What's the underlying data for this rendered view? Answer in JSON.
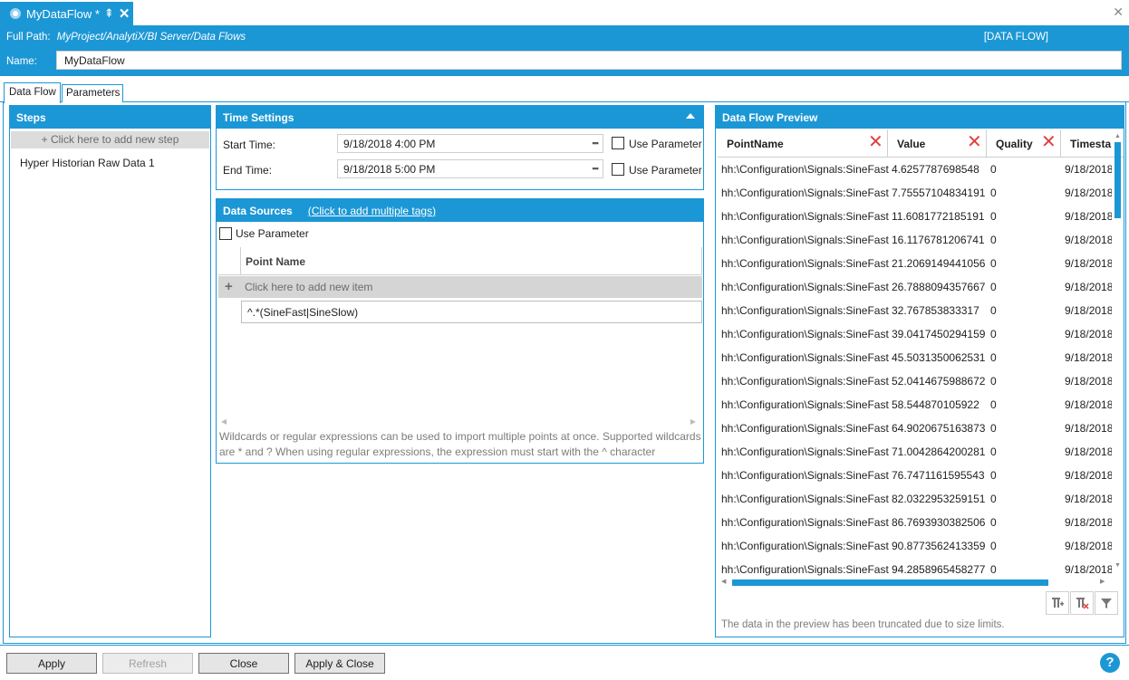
{
  "window": {
    "tab_title": "MyDataFlow *",
    "pin_glyph": "⇞",
    "tab_close_glyph": "✕",
    "close_glyph": "✕"
  },
  "header": {
    "full_path_label": "Full Path:",
    "full_path_value": "MyProject/AnalytiX/BI Server/Data Flows",
    "type_tag": "[DATA FLOW]",
    "name_label": "Name:",
    "name_value": "MyDataFlow"
  },
  "tabs": [
    {
      "label": "Data Flow",
      "active": true
    },
    {
      "label": "Parameters",
      "active": false
    }
  ],
  "steps": {
    "title": "Steps",
    "add_label": "+ Click here to add new step",
    "items": [
      {
        "label": "Hyper Historian Raw Data  1"
      }
    ]
  },
  "time_settings": {
    "title": "Time Settings",
    "start_label": "Start Time:",
    "start_value": "9/18/2018 4:00 PM",
    "end_label": "End Time:",
    "end_value": "9/18/2018 5:00 PM",
    "use_parameter_label": "Use Parameter",
    "calendar_icon": "calendar-grid-icon"
  },
  "data_sources": {
    "title": "Data Sources",
    "add_tags_link": "(Click to add multiple tags)",
    "use_parameter_label": "Use Parameter",
    "column_header": "Point Name",
    "add_item_label": "Click here to add new item",
    "add_item_plus": "+",
    "rows": [
      "^.*(SineFast|SineSlow)"
    ],
    "hint": "Wildcards or regular expressions can be used to import multiple points at once. Supported wildcards are * and ? When using regular expressions, the expression must start with the ^ character"
  },
  "preview": {
    "title": "Data Flow Preview",
    "columns": [
      "PointName",
      "Value",
      "Quality",
      "Timesta"
    ],
    "rows": [
      [
        "hh:\\Configuration\\Signals:SineFast",
        "4.6257787698548",
        "0",
        "9/18/2018"
      ],
      [
        "hh:\\Configuration\\Signals:SineFast",
        "7.75557104834191",
        "0",
        "9/18/2018"
      ],
      [
        "hh:\\Configuration\\Signals:SineFast",
        "11.6081772185191",
        "0",
        "9/18/2018"
      ],
      [
        "hh:\\Configuration\\Signals:SineFast",
        "16.1176781206741",
        "0",
        "9/18/2018"
      ],
      [
        "hh:\\Configuration\\Signals:SineFast",
        "21.2069149441056",
        "0",
        "9/18/2018"
      ],
      [
        "hh:\\Configuration\\Signals:SineFast",
        "26.7888094357667",
        "0",
        "9/18/2018"
      ],
      [
        "hh:\\Configuration\\Signals:SineFast",
        "32.767853833317",
        "0",
        "9/18/2018"
      ],
      [
        "hh:\\Configuration\\Signals:SineFast",
        "39.0417450294159",
        "0",
        "9/18/2018"
      ],
      [
        "hh:\\Configuration\\Signals:SineFast",
        "45.5031350062531",
        "0",
        "9/18/2018"
      ],
      [
        "hh:\\Configuration\\Signals:SineFast",
        "52.0414675988672",
        "0",
        "9/18/2018"
      ],
      [
        "hh:\\Configuration\\Signals:SineFast",
        "58.544870105922",
        "0",
        "9/18/2018"
      ],
      [
        "hh:\\Configuration\\Signals:SineFast",
        "64.9020675163873",
        "0",
        "9/18/2018"
      ],
      [
        "hh:\\Configuration\\Signals:SineFast",
        "71.0042864200281",
        "0",
        "9/18/2018"
      ],
      [
        "hh:\\Configuration\\Signals:SineFast",
        "76.7471161595543",
        "0",
        "9/18/2018"
      ],
      [
        "hh:\\Configuration\\Signals:SineFast",
        "82.0322953259151",
        "0",
        "9/18/2018"
      ],
      [
        "hh:\\Configuration\\Signals:SineFast",
        "86.7693930382506",
        "0",
        "9/18/2018"
      ],
      [
        "hh:\\Configuration\\Signals:SineFast",
        "90.8773562413359",
        "0",
        "9/18/2018"
      ],
      [
        "hh:\\Configuration\\Signals:SineFast",
        "94.2858965458277",
        "0",
        "9/18/2018"
      ]
    ],
    "remove_glyph": "✕",
    "tool_icons": [
      "add-column-icon",
      "remove-column-icon",
      "filter-icon"
    ],
    "truncated_note": "The data in the preview has been truncated due to size limits."
  },
  "footer": {
    "apply": "Apply",
    "refresh": "Refresh",
    "close": "Close",
    "apply_close": "Apply & Close",
    "help": "?"
  },
  "colors": {
    "accent": "#1c97d5",
    "remove_red": "#e04040"
  }
}
